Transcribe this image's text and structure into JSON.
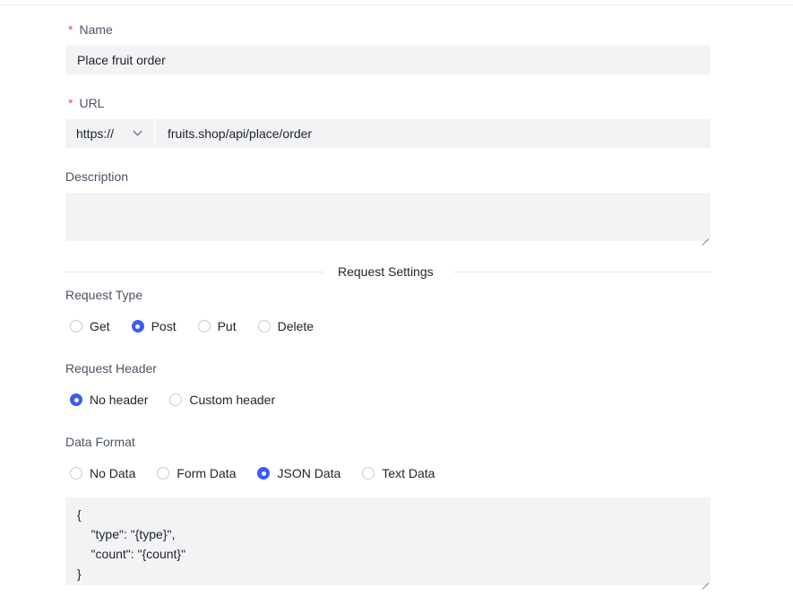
{
  "form": {
    "name": {
      "label": "Name",
      "required_mark": "*",
      "value": "Place fruit order"
    },
    "url": {
      "label": "URL",
      "required_mark": "*",
      "protocol": "https://",
      "value": "fruits.shop/api/place/order"
    },
    "description": {
      "label": "Description",
      "value": ""
    },
    "section_title": "Request Settings",
    "request_type": {
      "label": "Request Type",
      "options": [
        "Get",
        "Post",
        "Put",
        "Delete"
      ],
      "selected": "Post"
    },
    "request_header": {
      "label": "Request Header",
      "options": [
        "No header",
        "Custom header"
      ],
      "selected": "No header"
    },
    "data_format": {
      "label": "Data Format",
      "options": [
        "No Data",
        "Form Data",
        "JSON Data",
        "Text Data"
      ],
      "selected": "JSON Data"
    },
    "body": {
      "lines": [
        "{",
        "    \"type\": \"{type}\",",
        "    \"count\": \"{count}\"",
        "}"
      ]
    }
  },
  "colors": {
    "accent": "#3b5bf6",
    "required": "#e34d59",
    "field_bg": "#f2f3f5"
  },
  "icons": {
    "protocol_dropdown": "chevron-down-icon",
    "textarea_resize": "resize-grip-icon"
  }
}
